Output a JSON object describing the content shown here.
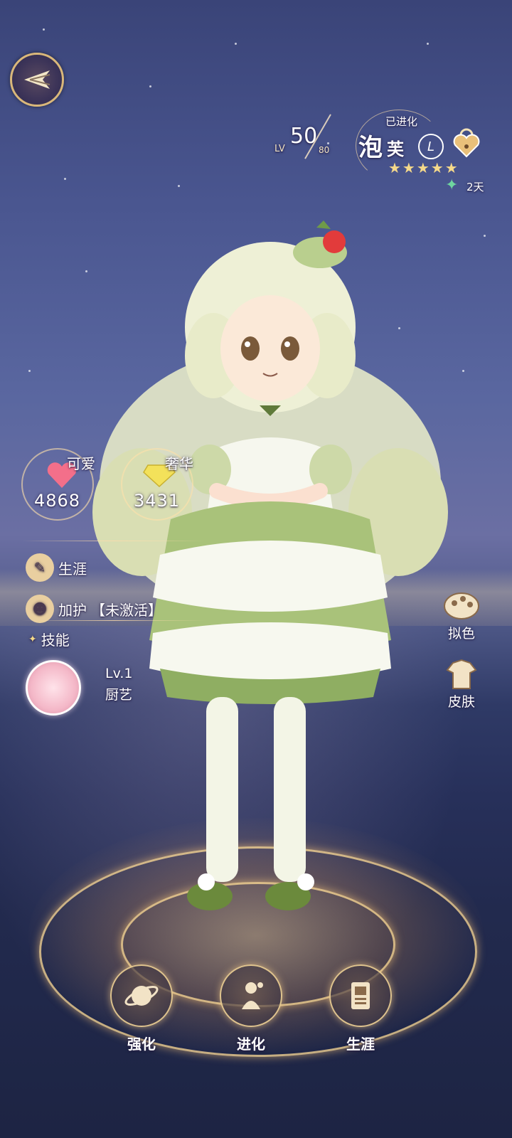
{
  "header": {
    "level_label": "LV",
    "level_current": "50",
    "level_max": "80",
    "evolved_label": "已进化",
    "name_char1": "泡",
    "name_char2": "芙",
    "rank_letter": "L",
    "stars": "★★★★★",
    "days_text": "2天"
  },
  "stats": {
    "cute_label": "可爱",
    "cute_value": "4868",
    "luxury_label": "奢华",
    "luxury_value": "3431"
  },
  "side_menu": {
    "career_label": "生涯",
    "protect_label": "加护",
    "protect_status": "【未激活】",
    "skill_label": "技能",
    "skill_level": "Lv.1",
    "skill_name": "厨艺"
  },
  "right_menu": {
    "mimic_label": "拟色",
    "skin_label": "皮肤"
  },
  "bottom_menu": {
    "enhance_label": "强化",
    "evolve_label": "进化",
    "career_label": "生涯"
  },
  "colors": {
    "accent_gold": "#d9b77a",
    "heart_pink": "#f36f8a",
    "gem_yellow": "#f3e15a",
    "dress_green": "#8fae62"
  },
  "icons": {
    "back": "back-arrow-icon",
    "lock": "heart-lock-icon",
    "cute": "heart-icon",
    "luxury": "diamond-icon",
    "career": "scroll-icon",
    "protect": "shield-figure-icon",
    "skill": "sparkle-icon",
    "mimic": "palette-icon",
    "skin": "costume-icon",
    "enhance": "planet-icon",
    "evolve": "figure-icon",
    "bottom_career": "book-icon"
  }
}
